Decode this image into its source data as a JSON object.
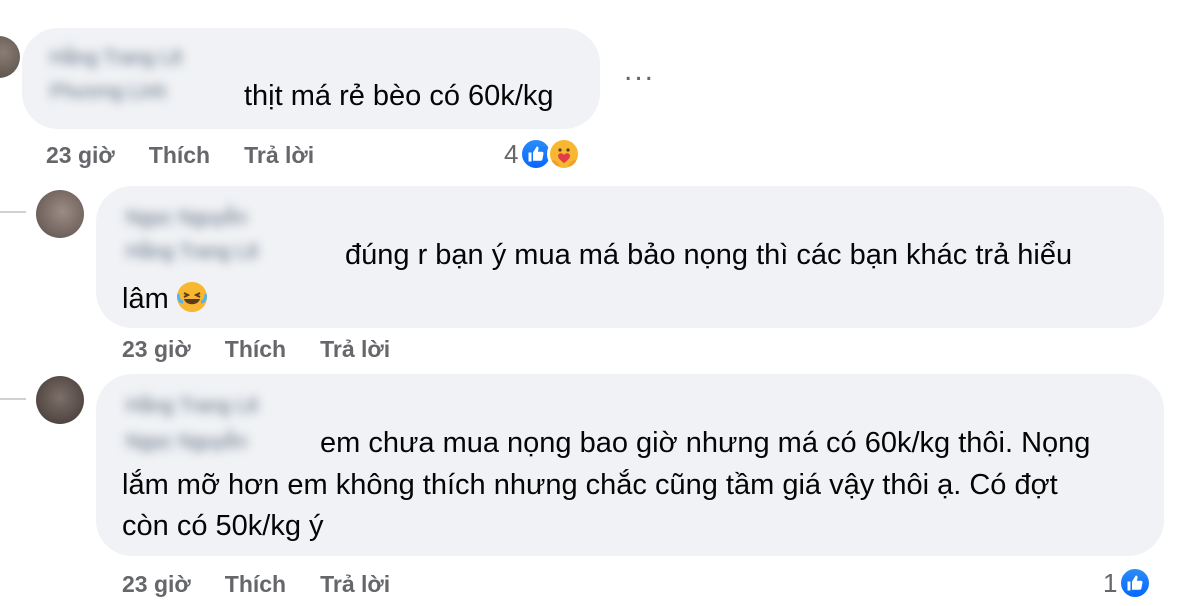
{
  "comments": [
    {
      "name_blurred": "Hằng Trang Lê",
      "name_blurred_2": "Phương Linh",
      "text": "thịt má rẻ bèo có 60k/kg",
      "time": "23 giờ",
      "like_label": "Thích",
      "reply_label": "Trả lời",
      "reaction_count": "4",
      "reactions": [
        "like-icon",
        "care-icon"
      ]
    },
    {
      "name_blurred": "Ngọc Nguyễn",
      "name_blurred_2": "Hằng Trang Lê",
      "text_line1": "đúng r bạn ý mua má bảo nọng thì các bạn khác trả hiểu",
      "text_line2": "lâm",
      "emoji": "laughing-tears-emoji",
      "time": "23 giờ",
      "like_label": "Thích",
      "reply_label": "Trả lời"
    },
    {
      "name_blurred": "Hằng Trang Lê",
      "name_blurred_2": "Ngọc Nguyễn",
      "text_line1": "em chưa mua nọng bao giờ nhưng má có 60k/kg thôi. Nọng",
      "text_line2": "lắm mỡ hơn em không thích nhưng chắc cũng tầm giá vậy thôi ạ. Có đợt",
      "text_line3": "còn có 50k/kg ý",
      "time": "23 giờ",
      "like_label": "Thích",
      "reply_label": "Trả lời",
      "reaction_count": "1",
      "reactions": [
        "like-icon"
      ]
    }
  ],
  "more_options": "...",
  "colors": {
    "bubble": "#f0f2f5",
    "meta": "#65676b",
    "like": "#0866ff"
  }
}
